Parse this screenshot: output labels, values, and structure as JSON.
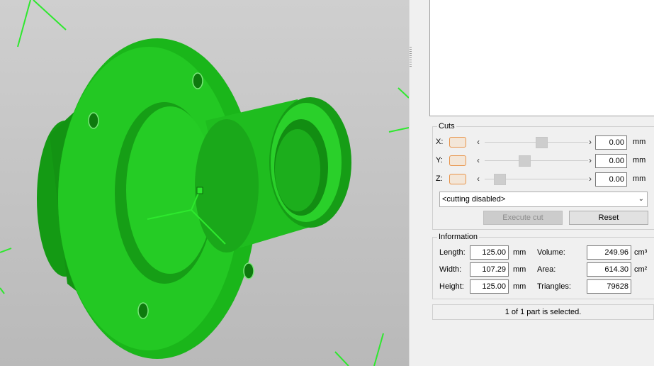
{
  "colors": {
    "part": "#1ec81e",
    "axis": "#2ee82e",
    "accent": "#e8944a"
  },
  "cuts": {
    "title": "Cuts",
    "axes": [
      {
        "label": "X:",
        "value": "0.00",
        "unit": "mm",
        "slider_position": 0.55
      },
      {
        "label": "Y:",
        "value": "0.00",
        "unit": "mm",
        "slider_position": 0.37
      },
      {
        "label": "Z:",
        "value": "0.00",
        "unit": "mm",
        "slider_position": 0.1
      }
    ],
    "mode_select": "<cutting disabled>",
    "execute_label": "Execute cut",
    "reset_label": "Reset"
  },
  "info": {
    "title": "Information",
    "length_label": "Length:",
    "length_value": "125.00",
    "length_unit": "mm",
    "width_label": "Width:",
    "width_value": "107.29",
    "width_unit": "mm",
    "height_label": "Height:",
    "height_value": "125.00",
    "height_unit": "mm",
    "volume_label": "Volume:",
    "volume_value": "249.96",
    "volume_unit": "cm³",
    "area_label": "Area:",
    "area_value": "614.30",
    "area_unit": "cm²",
    "triangles_label": "Triangles:",
    "triangles_value": "79628"
  },
  "status": "1 of 1 part is selected.",
  "icons": {
    "left_arrow": "‹",
    "right_arrow": "›",
    "dropdown": "chevron-down-icon"
  }
}
